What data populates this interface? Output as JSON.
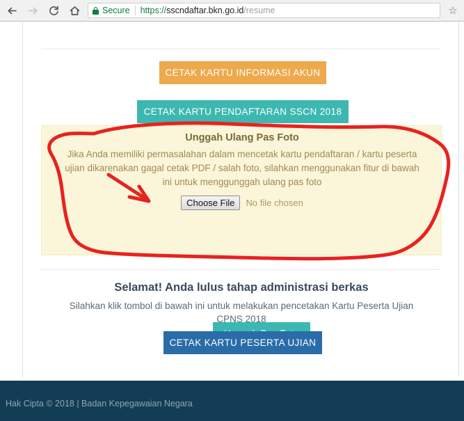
{
  "browser": {
    "back_icon": "arrow-left-icon",
    "forward_icon": "arrow-right-icon",
    "reload_icon": "reload-icon",
    "home_icon": "home-icon",
    "lock_icon": "lock-icon",
    "security_label": "Secure",
    "url_scheme": "https://",
    "url_host": "sscndaftar.bkn.go.id",
    "url_path": "/resume",
    "url_full": "https://sscndaftar.bkn.go.id/resume",
    "star_icon": "star-outline-icon",
    "star_glyph": "☆"
  },
  "page": {
    "buttons": {
      "print_account_info": "CETAK KARTU INFORMASI AKUN",
      "print_registration_card": "CETAK KARTU PENDAFTARAN SSCN 2018",
      "upload_photo": "Unggah Pas Foto",
      "print_exam_card": "CETAK KARTU PESERTA UJIAN"
    },
    "alert": {
      "title": "Unggah Ulang Pas Foto",
      "body": "Jika Anda memiliki permasalahan dalam mencetak kartu pendaftaran / kartu peserta ujian dikarenakan gagal cetak PDF / salah foto, silahkan menggunakan fitur di bawah ini untuk menggunggah ulang pas foto",
      "file_button_label": "Choose File",
      "file_status": "No file chosen"
    },
    "congrats": {
      "title": "Selamat! Anda lulus tahap administrasi berkas",
      "subtitle": "Silahkan klik tombol di bawah ini untuk melakukan pencetakan Kartu Peserta Ujian CPNS 2018"
    }
  },
  "footer": {
    "copyright": "Hak Cipta © 2018 | Badan Kepegawaian Negara"
  },
  "annotations": {
    "ellipse_name": "red-circle-highlight",
    "arrow_name": "red-arrow-pointer",
    "color": "#e8221f"
  },
  "colors": {
    "orange_button": "#eda94b",
    "teal_button": "#3cb8b0",
    "blue_button": "#2a6ca8",
    "alert_background": "#fbf5d9",
    "footer_background": "#123d55",
    "secure_green": "#0b8043"
  }
}
